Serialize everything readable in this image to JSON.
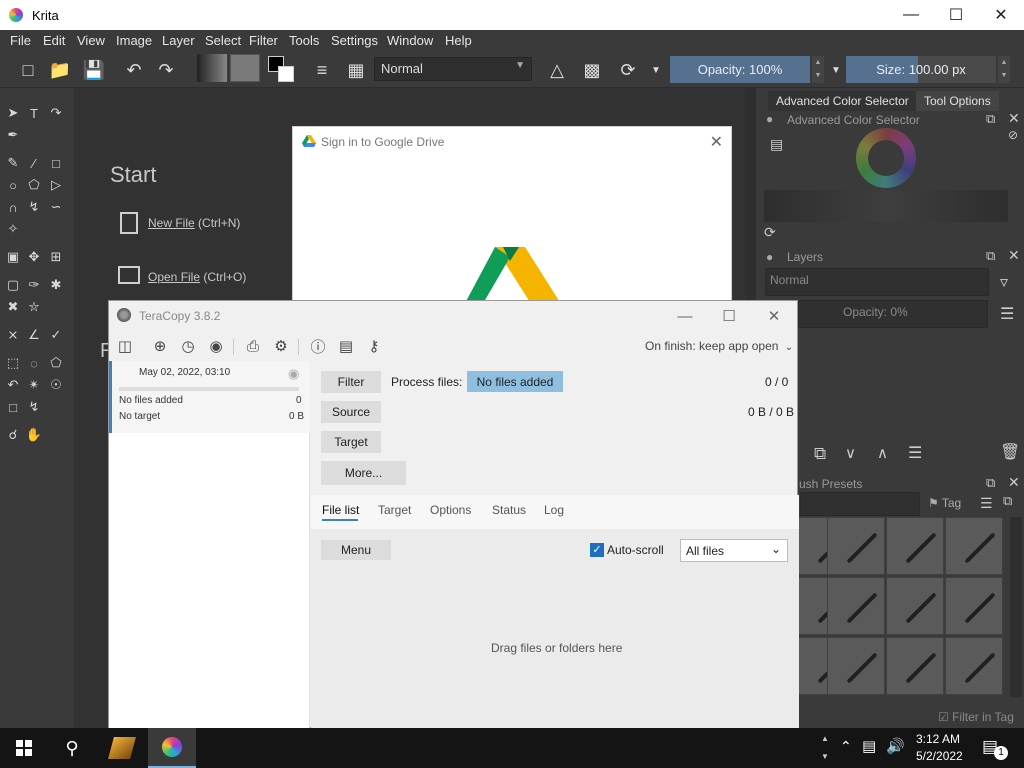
{
  "krita": {
    "title": "Krita",
    "menu": [
      "File",
      "Edit",
      "View",
      "Image",
      "Layer",
      "Select",
      "Filter",
      "Tools",
      "Settings",
      "Window",
      "Help"
    ],
    "blend_mode": "Normal",
    "opacity_label": "Opacity: 100%",
    "size_label": "Size: 100.00 px",
    "welcome": {
      "start": "Start",
      "new_file": "New File",
      "new_file_shortcut": "(Ctrl+N)",
      "open_file": "Open File",
      "open_file_shortcut": "(Ctrl+O)"
    },
    "dockers": {
      "tab_color": "Advanced Color Selector",
      "tab_tool": "Tool Options",
      "color_selector_title": "Advanced Color Selector",
      "layers_title": "Layers",
      "layers_blend": "Normal",
      "layers_opacity": "Opacity:  0%",
      "brush_presets_title": "ush Presets",
      "tag_label": "Tag",
      "filter_in_tag": "Filter in Tag"
    }
  },
  "gdrive": {
    "title": "Sign in to Google Drive"
  },
  "teracopy": {
    "title": "TeraCopy 3.8.2",
    "on_finish": "On finish: keep app open",
    "job": {
      "date": "May 02, 2022, 03:10",
      "line1_label": "No files added",
      "line1_value": "0",
      "line2_label": "No target",
      "line2_value": "0 B"
    },
    "filter_btn": "Filter",
    "process_label": "Process files:",
    "process_value": "No files added",
    "count": "0 / 0",
    "source_btn": "Source",
    "size": "0 B / 0 B",
    "target_btn": "Target",
    "more_btn": "More...",
    "tabs": [
      "File list",
      "Target",
      "Options",
      "Status",
      "Log"
    ],
    "menu_btn": "Menu",
    "autoscroll": "Auto-scroll",
    "files_filter": "All files",
    "drop_hint": "Drag files or folders here"
  },
  "taskbar": {
    "time": "3:12 AM",
    "date": "5/2/2022",
    "notification_count": "1"
  }
}
